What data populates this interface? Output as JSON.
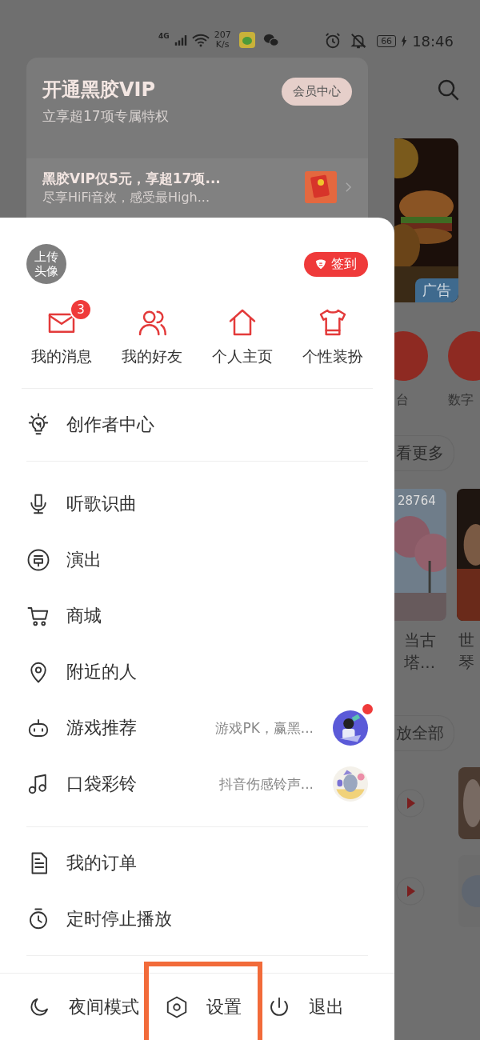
{
  "status_bar": {
    "network": "4G",
    "speed_value": "207",
    "speed_unit": "K/s",
    "battery": "66",
    "time": "18:46"
  },
  "vip_card": {
    "title": "开通黑胶VIP",
    "subtitle": "立享超17项专属特权",
    "button": "会员中心",
    "promo_title": "黑胶VIP仅5元，享超17项...",
    "promo_text": "尽享HiFi音效，感受最High..."
  },
  "profile": {
    "avatar_label": "上传头像",
    "checkin": "签到"
  },
  "shortcuts": [
    {
      "label": "我的消息",
      "badge": "3"
    },
    {
      "label": "我的好友"
    },
    {
      "label": "个人主页"
    },
    {
      "label": "个性装扮"
    }
  ],
  "menu_groups": [
    {
      "items": [
        {
          "kind": "plain",
          "label": "创作者中心"
        }
      ]
    },
    {
      "items": [
        {
          "kind": "plain",
          "label": "听歌识曲"
        },
        {
          "kind": "plain",
          "label": "演出"
        },
        {
          "kind": "plain",
          "label": "商城"
        },
        {
          "kind": "plain",
          "label": "附近的人"
        },
        {
          "kind": "promo",
          "label": "游戏推荐",
          "hint": "游戏PK，赢黑...",
          "dot": true
        },
        {
          "kind": "promo",
          "label": "口袋彩铃",
          "hint": "抖音伤感铃声...",
          "dot": false
        }
      ]
    },
    {
      "items": [
        {
          "kind": "plain",
          "label": "我的订单"
        },
        {
          "kind": "plain",
          "label": "定时停止播放"
        }
      ]
    }
  ],
  "bottom_bar": [
    {
      "label": "夜间模式",
      "highlighted": false
    },
    {
      "label": "设置",
      "highlighted": true
    },
    {
      "label": "退出",
      "highlighted": false
    }
  ],
  "background": {
    "ad_label": "广告",
    "tile_labels": [
      "台",
      "数字"
    ],
    "more_chip": "看更多",
    "play_count": "28764",
    "card_titles": [
      {
        "line1": "当古",
        "line2": "塔..."
      },
      {
        "line1": "世",
        "line2": "琴"
      }
    ],
    "play_all_chip": "放全部"
  }
}
